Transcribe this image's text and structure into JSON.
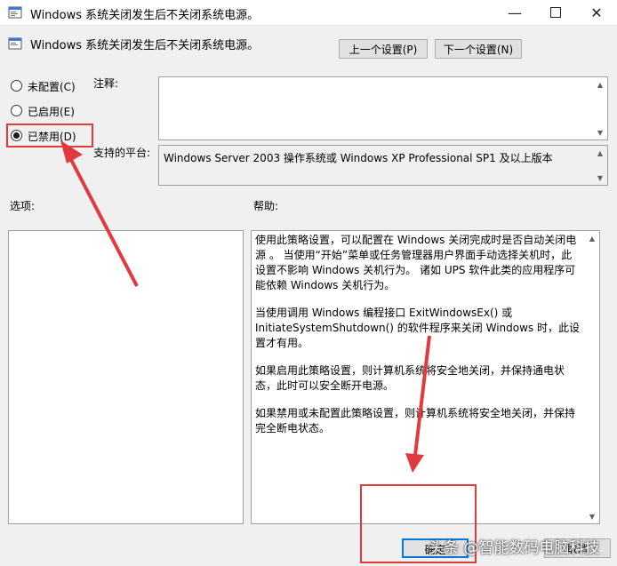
{
  "window": {
    "title": "Windows 系统关闭发生后不关闭系统电源。",
    "minimize_icon": "minimize-icon",
    "maximize_icon": "maximize-icon",
    "close_icon": "close-icon"
  },
  "header": {
    "policy_title": "Windows 系统关闭发生后不关闭系统电源。",
    "prev_button": "上一个设置(P)",
    "next_button": "下一个设置(N)"
  },
  "state": {
    "options": [
      {
        "label": "未配置(C)",
        "checked": false
      },
      {
        "label": "已启用(E)",
        "checked": false
      },
      {
        "label": "已禁用(D)",
        "checked": true
      }
    ]
  },
  "comment": {
    "label": "注释:",
    "value": ""
  },
  "platform": {
    "label": "支持的平台:",
    "value": "Windows Server 2003 操作系统或 Windows XP Professional SP1 及以上版本"
  },
  "sections": {
    "options_label": "选项:",
    "help_label": "帮助:"
  },
  "help": {
    "paragraphs": [
      "使用此策略设置，可以配置在 Windows 关闭完成时是否自动关闭电源 。 当使用“开始”菜单或任务管理器用户界面手动选择关机时，此设置不影响 Windows 关机行为。 诸如 UPS 软件此类的应用程序可能依赖 Windows 关机行为。",
      "当使用调用 Windows 编程接口 ExitWindowsEx() 或 InitiateSystemShutdown() 的软件程序来关闭 Windows 时，此设置才有用。",
      "如果启用此策略设置，则计算机系统将安全地关闭，并保持通电状态，此时可以安全断开电源。",
      "如果禁用或未配置此策略设置，则计算机系统将安全地关闭，并保持完全断电状态。"
    ]
  },
  "footer": {
    "ok_button": "确定",
    "cancel_button": "取消"
  },
  "watermark": "头条 @智能数码电脑科技",
  "colors": {
    "annotation_red": "#e0393e"
  }
}
